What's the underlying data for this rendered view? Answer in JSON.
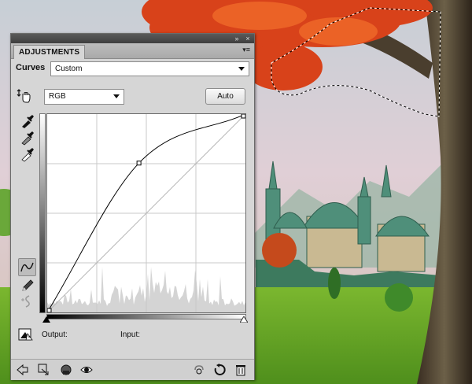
{
  "panel": {
    "tab_title": "ADJUSTMENTS",
    "adjustment_name": "Curves",
    "preset": "Custom",
    "channel": "RGB",
    "auto_label": "Auto",
    "output_label": "Output:",
    "input_label": "Input:"
  },
  "curve": {
    "points": [
      [
        0,
        0
      ],
      [
        118,
        192
      ],
      [
        255,
        255
      ]
    ]
  },
  "colors": {
    "panel_bg": "#d6d6d6",
    "curve": "#000000",
    "grid": "#c8c8c8",
    "histogram": "#d4d4d4"
  },
  "icons": {
    "target_adjust": "hand-target-icon",
    "black_point": "eyedropper-black-icon",
    "gray_point": "eyedropper-gray-icon",
    "white_point": "eyedropper-white-icon",
    "curve_tool": "curve-edit-icon",
    "pencil_tool": "pencil-icon",
    "smooth_tool": "smooth-icon",
    "clipping": "clipping-warning-icon"
  }
}
